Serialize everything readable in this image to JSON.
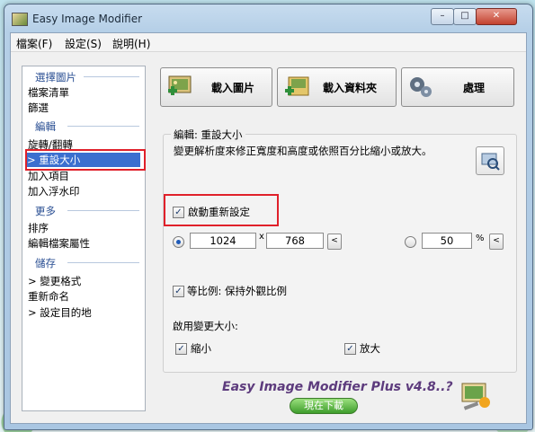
{
  "window": {
    "title": "Easy Image Modifier",
    "minimize": "–",
    "maximize": "□",
    "close": "✕"
  },
  "menu": [
    "檔案(F)",
    "設定(S)",
    "說明(H)"
  ],
  "sidebar": {
    "sections": [
      {
        "title": "選擇圖片",
        "items": [
          "檔案清單",
          "篩選"
        ]
      },
      {
        "title": "編輯",
        "items": [
          "旋轉/翻轉",
          "> 重設大小",
          "加入項目",
          "加入浮水印"
        ]
      },
      {
        "title": "更多",
        "items": [
          "排序",
          "編輯檔案屬性"
        ]
      },
      {
        "title": "儲存",
        "items": [
          "> 變更格式",
          "重新命名",
          "> 設定目的地"
        ]
      }
    ],
    "selected": "> 重設大小"
  },
  "toolbar": {
    "load_images": "載入圖片",
    "load_folder": "載入資料夾",
    "process": "處理"
  },
  "panel": {
    "title": "編輯: 重設大小",
    "description": "變更解析度來修正寬度和高度或依照百分比縮小或放大。",
    "enable_label": "啟動重新設定",
    "enable_checked": true,
    "width": "1024",
    "times": "x",
    "height": "768",
    "arrow": "<",
    "percent_value": "50",
    "percent_sign": "%",
    "keep_ratio_label": "等比例: 保持外觀比例",
    "keep_ratio_checked": true,
    "enable_resize_label": "啟用變更大小:",
    "shrink_label": "縮小",
    "enlarge_label": "放大"
  },
  "promo": {
    "text": "Easy Image Modifier Plus v4.8..?",
    "download": "現在下載"
  },
  "colors": {
    "selection": "#3b6fcf",
    "highlight_box": "#e0202a",
    "promo_text": "#5d3b7d",
    "download_button": "#3e9d2c"
  }
}
